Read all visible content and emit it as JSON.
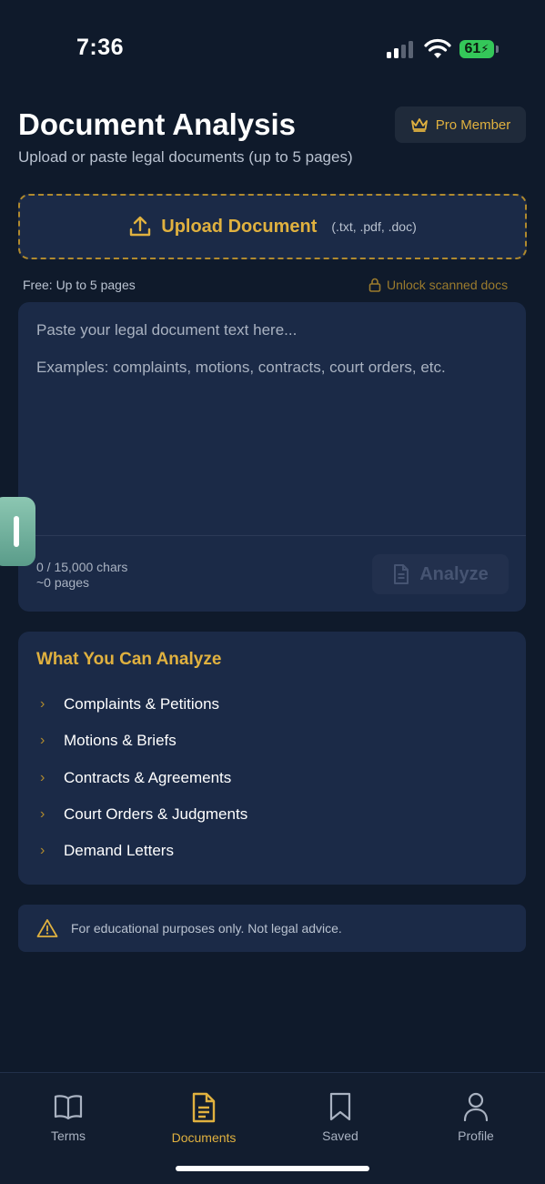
{
  "status_bar": {
    "time": "7:36",
    "battery": "61"
  },
  "header": {
    "title": "Document Analysis",
    "subtitle": "Upload or paste legal documents (up to 5 pages)",
    "badge": "Pro Member"
  },
  "upload": {
    "label": "Upload Document",
    "types": "(.txt, .pdf, .doc)"
  },
  "limits": {
    "free_note": "Free: Up to 5 pages",
    "unlock": "Unlock scanned docs"
  },
  "editor": {
    "placeholder_line1": "Paste your legal document text here...",
    "placeholder_line2": "Examples: complaints, motions, contracts, court orders, etc.",
    "char_count": "0 / 15,000 chars",
    "page_count": "~0 pages",
    "analyze_label": "Analyze"
  },
  "analyze_list": {
    "title": "What You Can Analyze",
    "items": [
      "Complaints & Petitions",
      "Motions & Briefs",
      "Contracts & Agreements",
      "Court Orders & Judgments",
      "Demand Letters"
    ]
  },
  "disclaimer": "For educational purposes only. Not legal advice.",
  "tabs": [
    {
      "label": "Terms",
      "icon": "book-icon",
      "active": false
    },
    {
      "label": "Documents",
      "icon": "document-icon",
      "active": true
    },
    {
      "label": "Saved",
      "icon": "bookmark-icon",
      "active": false
    },
    {
      "label": "Profile",
      "icon": "person-icon",
      "active": false
    }
  ],
  "colors": {
    "accent": "#e0b13f",
    "background": "#0f1a2b",
    "card": "#1b2a47"
  }
}
